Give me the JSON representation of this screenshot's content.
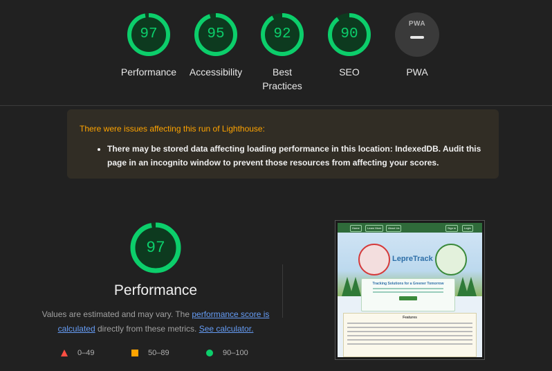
{
  "gauges": [
    {
      "score": "97",
      "label": "Performance",
      "fraction": 0.97
    },
    {
      "score": "95",
      "label": "Accessibility",
      "fraction": 0.95
    },
    {
      "score": "92",
      "label": "Best Practices",
      "fraction": 0.92
    },
    {
      "score": "90",
      "label": "SEO",
      "fraction": 0.9
    }
  ],
  "pwa": {
    "badge": "PWA",
    "label": "PWA"
  },
  "warning": {
    "title": "There were issues affecting this run of Lighthouse:",
    "item": "There may be stored data affecting loading performance in this location: IndexedDB. Audit this page in an incognito window to prevent those resources from affecting your scores."
  },
  "performance": {
    "score": "97",
    "fraction": 0.97,
    "title": "Performance",
    "desc_prefix": "Values are estimated and may vary. The ",
    "link_score": "performance score is calculated",
    "desc_middle": " directly from these metrics. ",
    "link_calc": "See calculator."
  },
  "legend": [
    {
      "range": "0–49",
      "color": "#ff4e42",
      "shape": "triangle"
    },
    {
      "range": "50–89",
      "color": "#ffa400",
      "shape": "square"
    },
    {
      "range": "90–100",
      "color": "#0cce6b",
      "shape": "circle"
    }
  ],
  "screenshot": {
    "nav": [
      "Home",
      "Learn More",
      "About Us",
      "Sign in",
      "Login"
    ],
    "brand": "LepreTrack",
    "tagline": "Empowering individuals for a Greener Tomorrow",
    "card_title": "Tracking Solutions for a Greener Tomorrow",
    "features": "Features"
  },
  "colors": {
    "pass": "#0cce6b",
    "average": "#ffa400",
    "fail": "#ff4e42",
    "link": "#669df6",
    "warning_title": "#ffa400"
  }
}
